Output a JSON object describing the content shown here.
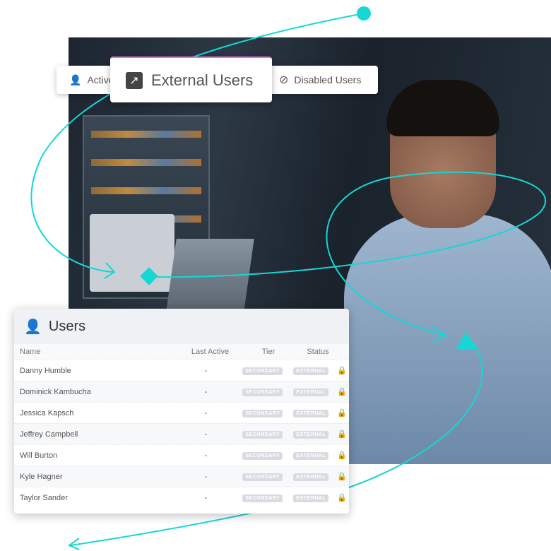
{
  "tabs": {
    "active": "Active Users",
    "external": "External Users",
    "disabled": "Disabled Users"
  },
  "users_card": {
    "title": "Users",
    "columns": [
      "Name",
      "Last Active",
      "Tier",
      "Status"
    ],
    "rows": [
      {
        "name": "Danny Humble",
        "last_active": "-",
        "tier": "SECONDARY",
        "status": "EXTERNAL"
      },
      {
        "name": "Dominick Kambucha",
        "last_active": "-",
        "tier": "SECONDARY",
        "status": "EXTERNAL"
      },
      {
        "name": "Jessica Kapsch",
        "last_active": "-",
        "tier": "SECONDARY",
        "status": "EXTERNAL"
      },
      {
        "name": "Jeffrey Campbell",
        "last_active": "-",
        "tier": "SECONDARY",
        "status": "EXTERNAL"
      },
      {
        "name": "Will Burton",
        "last_active": "-",
        "tier": "SECONDARY",
        "status": "EXTERNAL"
      },
      {
        "name": "Kyle Hagner",
        "last_active": "-",
        "tier": "SECONDARY",
        "status": "EXTERNAL"
      },
      {
        "name": "Taylor Sander",
        "last_active": "-",
        "tier": "SECONDARY",
        "status": "EXTERNAL"
      }
    ]
  },
  "colors": {
    "accent": "#16d6d6",
    "tab_highlight": "#e86ee8",
    "badge": "#d9dbe0"
  }
}
